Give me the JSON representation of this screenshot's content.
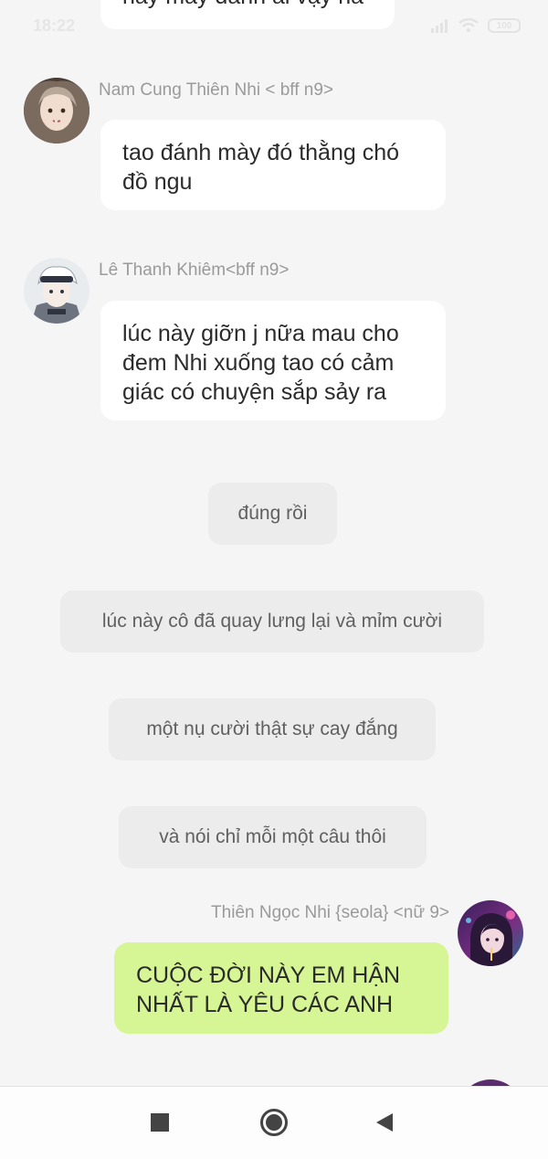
{
  "status_bar": {
    "time": "18:22",
    "battery": "100"
  },
  "messages": [
    {
      "text": "hay mày đánh ai vậy na"
    },
    {
      "sender": "Nam Cung Thiên Nhi < bff n9>",
      "text": "tao đánh mày đó thằng chó đồ ngu"
    },
    {
      "sender": "Lê Thanh Khiêm<bff n9>",
      "text": "lúc này giỡn j nữa mau cho đem Nhi xuống tao có cảm giác có chuyện sắp sảy ra"
    }
  ],
  "narrations": [
    "đúng rồi",
    "lúc này cô đã quay lưng lại và mỉm cười",
    "một nụ cười thật sự cay đắng",
    "và nói chỉ mỗi một câu thôi"
  ],
  "own_message": {
    "sender": "Thiên Ngọc Nhi {seola} <nữ 9>",
    "text": "CUỘC ĐỜI NÀY EM HẬN NHẤT LÀ YÊU CÁC ANH"
  },
  "colors": {
    "background": "#f5f5f5",
    "bubble": "#ffffff",
    "own_bubble": "#d6f594",
    "narration_bg": "#ececec",
    "name_text": "#9a9a9a"
  },
  "icons": {
    "nav_recent": "square-icon",
    "nav_home": "circle-home-icon",
    "nav_back": "triangle-back-icon"
  }
}
